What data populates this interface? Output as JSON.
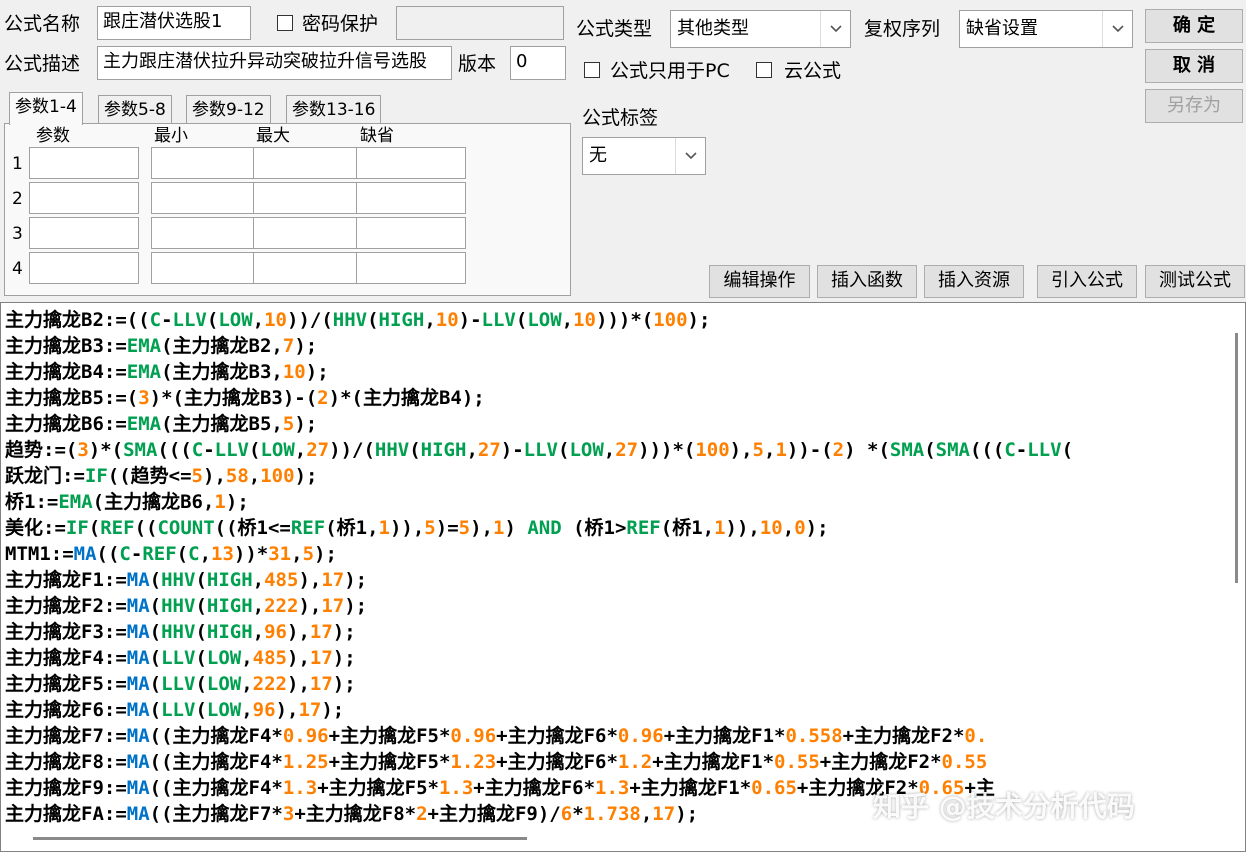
{
  "header": {
    "formula_name_label": "公式名称",
    "formula_name_value": "跟庄潜伏选股1",
    "password_protect_label": "密码保护",
    "password_value": "",
    "formula_desc_label": "公式描述",
    "formula_desc_value": "主力跟庄潜伏拉升异动突破拉升信号选股",
    "version_label": "版本",
    "version_value": "0",
    "formula_type_label": "公式类型",
    "formula_type_value": "其他类型",
    "rights_label": "复权序列",
    "rights_value": "缺省设置",
    "pc_only_label": "公式只用于PC",
    "cloud_label": "云公式",
    "tag_label": "公式标签",
    "tag_value": "无"
  },
  "buttons": {
    "ok": "确  定",
    "cancel": "取  消",
    "save_as": "另存为",
    "edit_ops": "编辑操作",
    "insert_func": "插入函数",
    "insert_res": "插入资源",
    "import_formula": "引入公式",
    "test_formula": "测试公式"
  },
  "params": {
    "tabs": [
      "参数1-4",
      "参数5-8",
      "参数9-12",
      "参数13-16"
    ],
    "columns": [
      "参数",
      "最小",
      "最大",
      "缺省"
    ],
    "rows": [
      "1",
      "2",
      "3",
      "4"
    ]
  },
  "code": {
    "lines": [
      [
        [
          "n",
          "主力擒龙B2:=(("
        ],
        [
          "f1",
          "C"
        ],
        [
          "n",
          "-"
        ],
        [
          "f1",
          "LLV"
        ],
        [
          "n",
          "("
        ],
        [
          "f1",
          "LOW"
        ],
        [
          "n",
          ","
        ],
        [
          "num",
          "10"
        ],
        [
          "n",
          "))/("
        ],
        [
          "f1",
          "HHV"
        ],
        [
          "n",
          "("
        ],
        [
          "f1",
          "HIGH"
        ],
        [
          "n",
          ","
        ],
        [
          "num",
          "10"
        ],
        [
          "n",
          ")-"
        ],
        [
          "f1",
          "LLV"
        ],
        [
          "n",
          "("
        ],
        [
          "f1",
          "LOW"
        ],
        [
          "n",
          ","
        ],
        [
          "num",
          "10"
        ],
        [
          "n",
          ")))*("
        ],
        [
          "num",
          "100"
        ],
        [
          "n",
          ");"
        ]
      ],
      [
        [
          "n",
          "主力擒龙B3:="
        ],
        [
          "f1",
          "EMA"
        ],
        [
          "n",
          "(主力擒龙B2,"
        ],
        [
          "num",
          "7"
        ],
        [
          "n",
          ");"
        ]
      ],
      [
        [
          "n",
          "主力擒龙B4:="
        ],
        [
          "f1",
          "EMA"
        ],
        [
          "n",
          "(主力擒龙B3,"
        ],
        [
          "num",
          "10"
        ],
        [
          "n",
          ");"
        ]
      ],
      [
        [
          "n",
          "主力擒龙B5:=("
        ],
        [
          "num",
          "3"
        ],
        [
          "n",
          ")*(主力擒龙B3)-("
        ],
        [
          "num",
          "2"
        ],
        [
          "n",
          ")*(主力擒龙B4);"
        ]
      ],
      [
        [
          "n",
          "主力擒龙B6:="
        ],
        [
          "f1",
          "EMA"
        ],
        [
          "n",
          "(主力擒龙B5,"
        ],
        [
          "num",
          "5"
        ],
        [
          "n",
          ");"
        ]
      ],
      [
        [
          "n",
          "趋势:=("
        ],
        [
          "num",
          "3"
        ],
        [
          "n",
          ")*("
        ],
        [
          "f1",
          "SMA"
        ],
        [
          "n",
          "((("
        ],
        [
          "f1",
          "C"
        ],
        [
          "n",
          "-"
        ],
        [
          "f1",
          "LLV"
        ],
        [
          "n",
          "("
        ],
        [
          "f1",
          "LOW"
        ],
        [
          "n",
          ","
        ],
        [
          "num",
          "27"
        ],
        [
          "n",
          "))/("
        ],
        [
          "f1",
          "HHV"
        ],
        [
          "n",
          "("
        ],
        [
          "f1",
          "HIGH"
        ],
        [
          "n",
          ","
        ],
        [
          "num",
          "27"
        ],
        [
          "n",
          ")-"
        ],
        [
          "f1",
          "LLV"
        ],
        [
          "n",
          "("
        ],
        [
          "f1",
          "LOW"
        ],
        [
          "n",
          ","
        ],
        [
          "num",
          "27"
        ],
        [
          "n",
          ")))*("
        ],
        [
          "num",
          "100"
        ],
        [
          "n",
          "),"
        ],
        [
          "num",
          "5"
        ],
        [
          "n",
          ","
        ],
        [
          "num",
          "1"
        ],
        [
          "n",
          "))-("
        ],
        [
          "num",
          "2"
        ],
        [
          "n",
          ") *("
        ],
        [
          "f1",
          "SMA"
        ],
        [
          "n",
          "("
        ],
        [
          "f1",
          "SMA"
        ],
        [
          "n",
          "((("
        ],
        [
          "f1",
          "C"
        ],
        [
          "n",
          "-"
        ],
        [
          "f1",
          "LLV"
        ],
        [
          "n",
          "("
        ]
      ],
      [
        [
          "n",
          "跃龙门:="
        ],
        [
          "f1",
          "IF"
        ],
        [
          "n",
          "((趋势<="
        ],
        [
          "num",
          "5"
        ],
        [
          "n",
          "),"
        ],
        [
          "num",
          "58"
        ],
        [
          "n",
          ","
        ],
        [
          "num",
          "100"
        ],
        [
          "n",
          ");"
        ]
      ],
      [
        [
          "n",
          "桥1:="
        ],
        [
          "f1",
          "EMA"
        ],
        [
          "n",
          "(主力擒龙B6,"
        ],
        [
          "num",
          "1"
        ],
        [
          "n",
          ");"
        ]
      ],
      [
        [
          "n",
          "美化:="
        ],
        [
          "f1",
          "IF"
        ],
        [
          "n",
          "("
        ],
        [
          "f1",
          "REF"
        ],
        [
          "n",
          "(("
        ],
        [
          "f1",
          "COUNT"
        ],
        [
          "n",
          "((桥1<="
        ],
        [
          "f1",
          "REF"
        ],
        [
          "n",
          "(桥1,"
        ],
        [
          "num",
          "1"
        ],
        [
          "n",
          ")),"
        ],
        [
          "num",
          "5"
        ],
        [
          "n",
          ")="
        ],
        [
          "num",
          "5"
        ],
        [
          "n",
          "),"
        ],
        [
          "num",
          "1"
        ],
        [
          "n",
          ") "
        ],
        [
          "kw",
          "AND"
        ],
        [
          "n",
          " (桥1>"
        ],
        [
          "f1",
          "REF"
        ],
        [
          "n",
          "(桥1,"
        ],
        [
          "num",
          "1"
        ],
        [
          "n",
          ")),"
        ],
        [
          "num",
          "10"
        ],
        [
          "n",
          ","
        ],
        [
          "num",
          "0"
        ],
        [
          "n",
          ");"
        ]
      ],
      [
        [
          "n",
          "MTM1:="
        ],
        [
          "f2",
          "MA"
        ],
        [
          "n",
          "(("
        ],
        [
          "f1",
          "C"
        ],
        [
          "n",
          "-"
        ],
        [
          "f1",
          "REF"
        ],
        [
          "n",
          "("
        ],
        [
          "f1",
          "C"
        ],
        [
          "n",
          ","
        ],
        [
          "num",
          "13"
        ],
        [
          "n",
          "))*"
        ],
        [
          "num",
          "31"
        ],
        [
          "n",
          ","
        ],
        [
          "num",
          "5"
        ],
        [
          "n",
          ");"
        ]
      ],
      [
        [
          "n",
          "主力擒龙F1:="
        ],
        [
          "f2",
          "MA"
        ],
        [
          "n",
          "("
        ],
        [
          "f1",
          "HHV"
        ],
        [
          "n",
          "("
        ],
        [
          "f1",
          "HIGH"
        ],
        [
          "n",
          ","
        ],
        [
          "num",
          "485"
        ],
        [
          "n",
          "),"
        ],
        [
          "num",
          "17"
        ],
        [
          "n",
          ");"
        ]
      ],
      [
        [
          "n",
          "主力擒龙F2:="
        ],
        [
          "f2",
          "MA"
        ],
        [
          "n",
          "("
        ],
        [
          "f1",
          "HHV"
        ],
        [
          "n",
          "("
        ],
        [
          "f1",
          "HIGH"
        ],
        [
          "n",
          ","
        ],
        [
          "num",
          "222"
        ],
        [
          "n",
          "),"
        ],
        [
          "num",
          "17"
        ],
        [
          "n",
          ");"
        ]
      ],
      [
        [
          "n",
          "主力擒龙F3:="
        ],
        [
          "f2",
          "MA"
        ],
        [
          "n",
          "("
        ],
        [
          "f1",
          "HHV"
        ],
        [
          "n",
          "("
        ],
        [
          "f1",
          "HIGH"
        ],
        [
          "n",
          ","
        ],
        [
          "num",
          "96"
        ],
        [
          "n",
          "),"
        ],
        [
          "num",
          "17"
        ],
        [
          "n",
          ");"
        ]
      ],
      [
        [
          "n",
          "主力擒龙F4:="
        ],
        [
          "f2",
          "MA"
        ],
        [
          "n",
          "("
        ],
        [
          "f1",
          "LLV"
        ],
        [
          "n",
          "("
        ],
        [
          "f1",
          "LOW"
        ],
        [
          "n",
          ","
        ],
        [
          "num",
          "485"
        ],
        [
          "n",
          "),"
        ],
        [
          "num",
          "17"
        ],
        [
          "n",
          ");"
        ]
      ],
      [
        [
          "n",
          "主力擒龙F5:="
        ],
        [
          "f2",
          "MA"
        ],
        [
          "n",
          "("
        ],
        [
          "f1",
          "LLV"
        ],
        [
          "n",
          "("
        ],
        [
          "f1",
          "LOW"
        ],
        [
          "n",
          ","
        ],
        [
          "num",
          "222"
        ],
        [
          "n",
          "),"
        ],
        [
          "num",
          "17"
        ],
        [
          "n",
          ");"
        ]
      ],
      [
        [
          "n",
          "主力擒龙F6:="
        ],
        [
          "f2",
          "MA"
        ],
        [
          "n",
          "("
        ],
        [
          "f1",
          "LLV"
        ],
        [
          "n",
          "("
        ],
        [
          "f1",
          "LOW"
        ],
        [
          "n",
          ","
        ],
        [
          "num",
          "96"
        ],
        [
          "n",
          "),"
        ],
        [
          "num",
          "17"
        ],
        [
          "n",
          ");"
        ]
      ],
      [
        [
          "n",
          "主力擒龙F7:="
        ],
        [
          "f2",
          "MA"
        ],
        [
          "n",
          "((主力擒龙F4*"
        ],
        [
          "num",
          "0.96"
        ],
        [
          "n",
          "+主力擒龙F5*"
        ],
        [
          "num",
          "0.96"
        ],
        [
          "n",
          "+主力擒龙F6*"
        ],
        [
          "num",
          "0.96"
        ],
        [
          "n",
          "+主力擒龙F1*"
        ],
        [
          "num",
          "0.558"
        ],
        [
          "n",
          "+主力擒龙F2*"
        ],
        [
          "num",
          "0."
        ]
      ],
      [
        [
          "n",
          "主力擒龙F8:="
        ],
        [
          "f2",
          "MA"
        ],
        [
          "n",
          "((主力擒龙F4*"
        ],
        [
          "num",
          "1.25"
        ],
        [
          "n",
          "+主力擒龙F5*"
        ],
        [
          "num",
          "1.23"
        ],
        [
          "n",
          "+主力擒龙F6*"
        ],
        [
          "num",
          "1.2"
        ],
        [
          "n",
          "+主力擒龙F1*"
        ],
        [
          "num",
          "0.55"
        ],
        [
          "n",
          "+主力擒龙F2*"
        ],
        [
          "num",
          "0.55"
        ]
      ],
      [
        [
          "n",
          "主力擒龙F9:="
        ],
        [
          "f2",
          "MA"
        ],
        [
          "n",
          "((主力擒龙F4*"
        ],
        [
          "num",
          "1.3"
        ],
        [
          "n",
          "+主力擒龙F5*"
        ],
        [
          "num",
          "1.3"
        ],
        [
          "n",
          "+主力擒龙F6*"
        ],
        [
          "num",
          "1.3"
        ],
        [
          "n",
          "+主力擒龙F1*"
        ],
        [
          "num",
          "0.65"
        ],
        [
          "n",
          "+主力擒龙F2*"
        ],
        [
          "num",
          "0.65"
        ],
        [
          "n",
          "+主"
        ]
      ],
      [
        [
          "n",
          "主力擒龙FA:="
        ],
        [
          "f2",
          "MA"
        ],
        [
          "n",
          "((主力擒龙F7*"
        ],
        [
          "num",
          "3"
        ],
        [
          "n",
          "+主力擒龙F8*"
        ],
        [
          "num",
          "2"
        ],
        [
          "n",
          "+主力擒龙F9)/"
        ],
        [
          "num",
          "6"
        ],
        [
          "n",
          "*"
        ],
        [
          "num",
          "1.738"
        ],
        [
          "n",
          ","
        ],
        [
          "num",
          "17"
        ],
        [
          "n",
          ");"
        ]
      ]
    ]
  },
  "watermark": "知乎 @技术分析代码",
  "colors": {
    "func_green": "#00a050",
    "func_blue": "#0073c8",
    "number_orange": "#ff8000"
  }
}
